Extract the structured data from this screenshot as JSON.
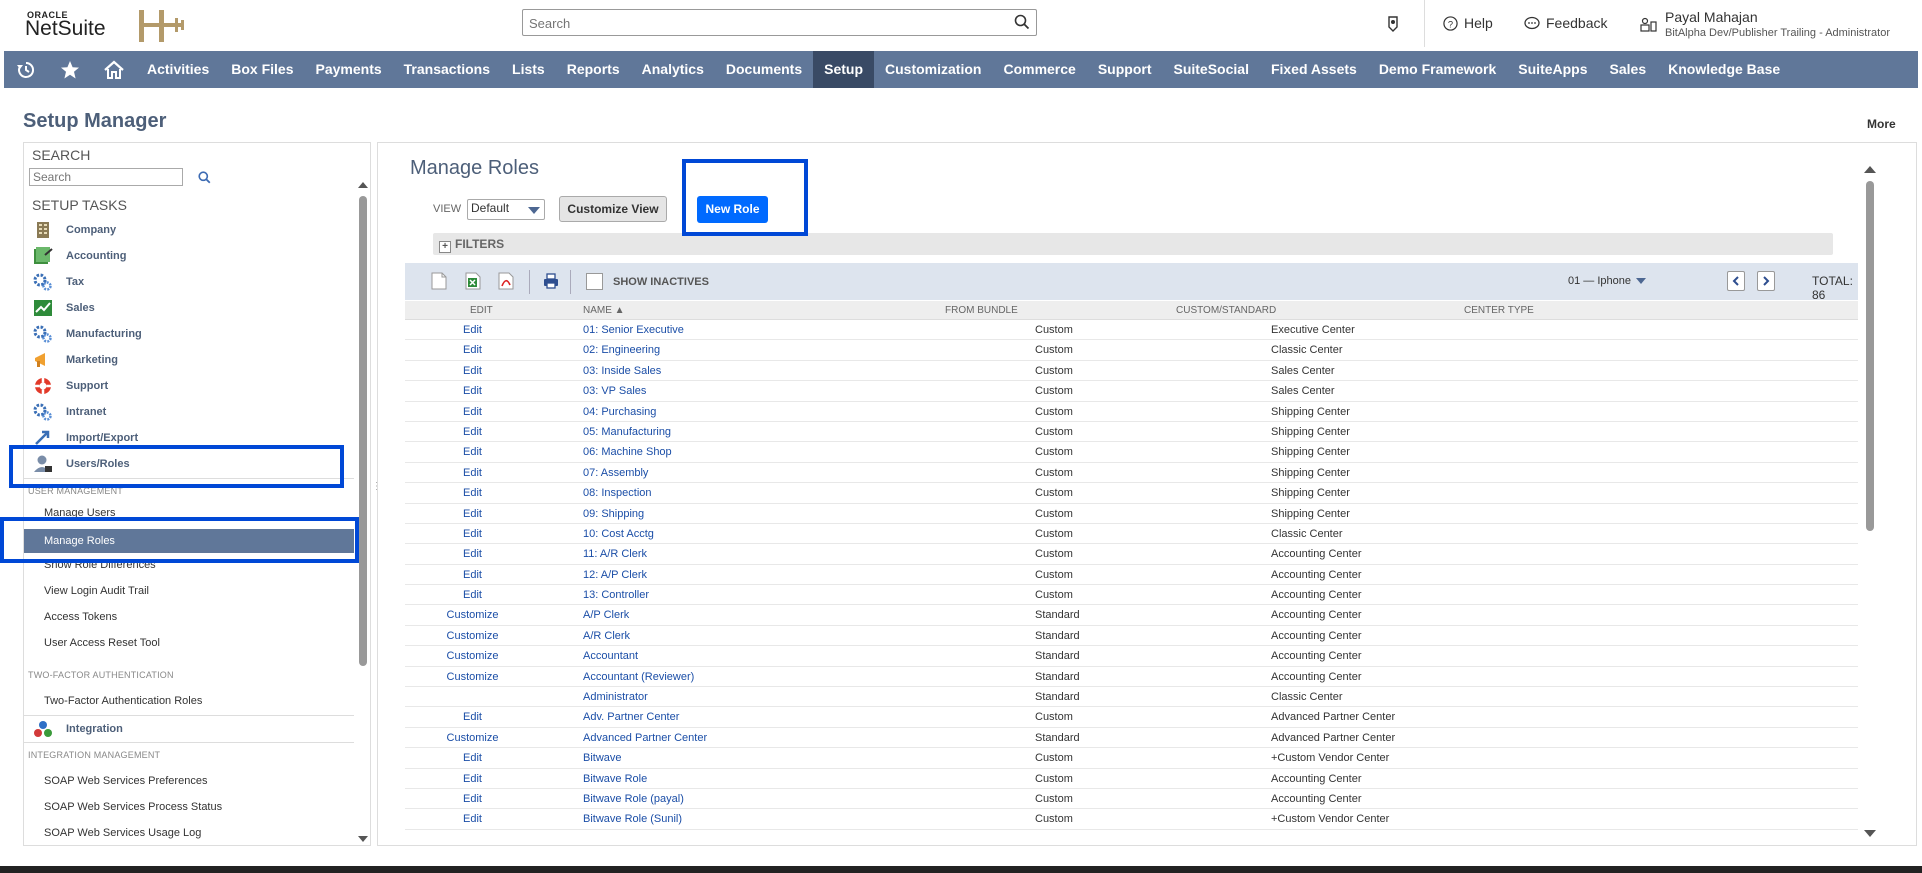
{
  "brand": {
    "oracle": "ORACLE",
    "netsuite": "NetSuite"
  },
  "search": {
    "placeholder": "Search"
  },
  "topbar": {
    "help": "Help",
    "feedback": "Feedback",
    "user_name": "Payal Mahajan",
    "user_role": "BitAlpha Dev/Publisher Trailing - Administrator"
  },
  "nav": {
    "items": [
      "Activities",
      "Box Files",
      "Payments",
      "Transactions",
      "Lists",
      "Reports",
      "Analytics",
      "Documents",
      "Setup",
      "Customization",
      "Commerce",
      "Support",
      "SuiteSocial",
      "Fixed Assets",
      "Demo Framework",
      "SuiteApps",
      "Sales",
      "Knowledge Base"
    ],
    "active": "Setup"
  },
  "page": {
    "title": "Setup Manager",
    "more": "More"
  },
  "left_panel": {
    "search_label": "SEARCH",
    "search_placeholder": "Search",
    "tasks_label": "SETUP TASKS",
    "tasks": [
      "Company",
      "Accounting",
      "Tax",
      "Sales",
      "Manufacturing",
      "Marketing",
      "Support",
      "Intranet",
      "Import/Export",
      "Users/Roles"
    ],
    "user_mgmt_header": "USER MANAGEMENT",
    "user_mgmt_items": [
      "Manage Users",
      "Manage Roles",
      "Show Role Differences",
      "View Login Audit Trail",
      "Access Tokens",
      "User Access Reset Tool"
    ],
    "active_item": "Manage Roles",
    "tfa_header": "TWO-FACTOR AUTHENTICATION",
    "tfa_items": [
      "Two-Factor Authentication Roles"
    ],
    "integration": "Integration",
    "integration_header": "INTEGRATION MANAGEMENT",
    "integration_items": [
      "SOAP Web Services Preferences",
      "SOAP Web Services Process Status",
      "SOAP Web Services Usage Log"
    ]
  },
  "main": {
    "title": "Manage Roles",
    "view_label": "VIEW",
    "view_value": "Default",
    "customize_view": "Customize View",
    "new_role": "New Role",
    "filters": "FILTERS",
    "show_inactives": "SHOW INACTIVES",
    "pager": "01 — Iphone",
    "total": "TOTAL: 86",
    "columns": {
      "edit": "EDIT",
      "name": "NAME ▲",
      "bundle": "FROM BUNDLE",
      "custom": "CUSTOM/STANDARD",
      "center": "CENTER TYPE"
    },
    "rows": [
      {
        "edit": "Edit",
        "name": "01: Senior Executive",
        "custom": "Custom",
        "center": "Executive Center"
      },
      {
        "edit": "Edit",
        "name": "02: Engineering",
        "custom": "Custom",
        "center": "Classic Center"
      },
      {
        "edit": "Edit",
        "name": "03: Inside Sales",
        "custom": "Custom",
        "center": "Sales Center"
      },
      {
        "edit": "Edit",
        "name": "03: VP Sales",
        "custom": "Custom",
        "center": "Sales Center"
      },
      {
        "edit": "Edit",
        "name": "04: Purchasing",
        "custom": "Custom",
        "center": "Shipping Center"
      },
      {
        "edit": "Edit",
        "name": "05: Manufacturing",
        "custom": "Custom",
        "center": "Shipping Center"
      },
      {
        "edit": "Edit",
        "name": "06: Machine Shop",
        "custom": "Custom",
        "center": "Shipping Center"
      },
      {
        "edit": "Edit",
        "name": "07: Assembly",
        "custom": "Custom",
        "center": "Shipping Center"
      },
      {
        "edit": "Edit",
        "name": "08: Inspection",
        "custom": "Custom",
        "center": "Shipping Center"
      },
      {
        "edit": "Edit",
        "name": "09: Shipping",
        "custom": "Custom",
        "center": "Shipping Center"
      },
      {
        "edit": "Edit",
        "name": "10: Cost Acctg",
        "custom": "Custom",
        "center": "Classic Center"
      },
      {
        "edit": "Edit",
        "name": "11: A/R Clerk",
        "custom": "Custom",
        "center": "Accounting Center"
      },
      {
        "edit": "Edit",
        "name": "12: A/P Clerk",
        "custom": "Custom",
        "center": "Accounting Center"
      },
      {
        "edit": "Edit",
        "name": "13: Controller",
        "custom": "Custom",
        "center": "Accounting Center"
      },
      {
        "edit": "Customize",
        "name": "A/P Clerk",
        "custom": "Standard",
        "center": "Accounting Center"
      },
      {
        "edit": "Customize",
        "name": "A/R Clerk",
        "custom": "Standard",
        "center": "Accounting Center"
      },
      {
        "edit": "Customize",
        "name": "Accountant",
        "custom": "Standard",
        "center": "Accounting Center"
      },
      {
        "edit": "Customize",
        "name": "Accountant (Reviewer)",
        "custom": "Standard",
        "center": "Accounting Center"
      },
      {
        "edit": "",
        "name": "Administrator",
        "custom": "Standard",
        "center": "Classic Center"
      },
      {
        "edit": "Edit",
        "name": "Adv. Partner Center",
        "custom": "Custom",
        "center": "Advanced Partner Center"
      },
      {
        "edit": "Customize",
        "name": "Advanced Partner Center",
        "custom": "Standard",
        "center": "Advanced Partner Center"
      },
      {
        "edit": "Edit",
        "name": "Bitwave",
        "custom": "Custom",
        "center": "+Custom Vendor Center"
      },
      {
        "edit": "Edit",
        "name": "Bitwave Role",
        "custom": "Custom",
        "center": "Accounting Center"
      },
      {
        "edit": "Edit",
        "name": "Bitwave Role (payal)",
        "custom": "Custom",
        "center": "Accounting Center"
      },
      {
        "edit": "Edit",
        "name": "Bitwave Role (Sunil)",
        "custom": "Custom",
        "center": "+Custom Vendor Center"
      }
    ]
  }
}
